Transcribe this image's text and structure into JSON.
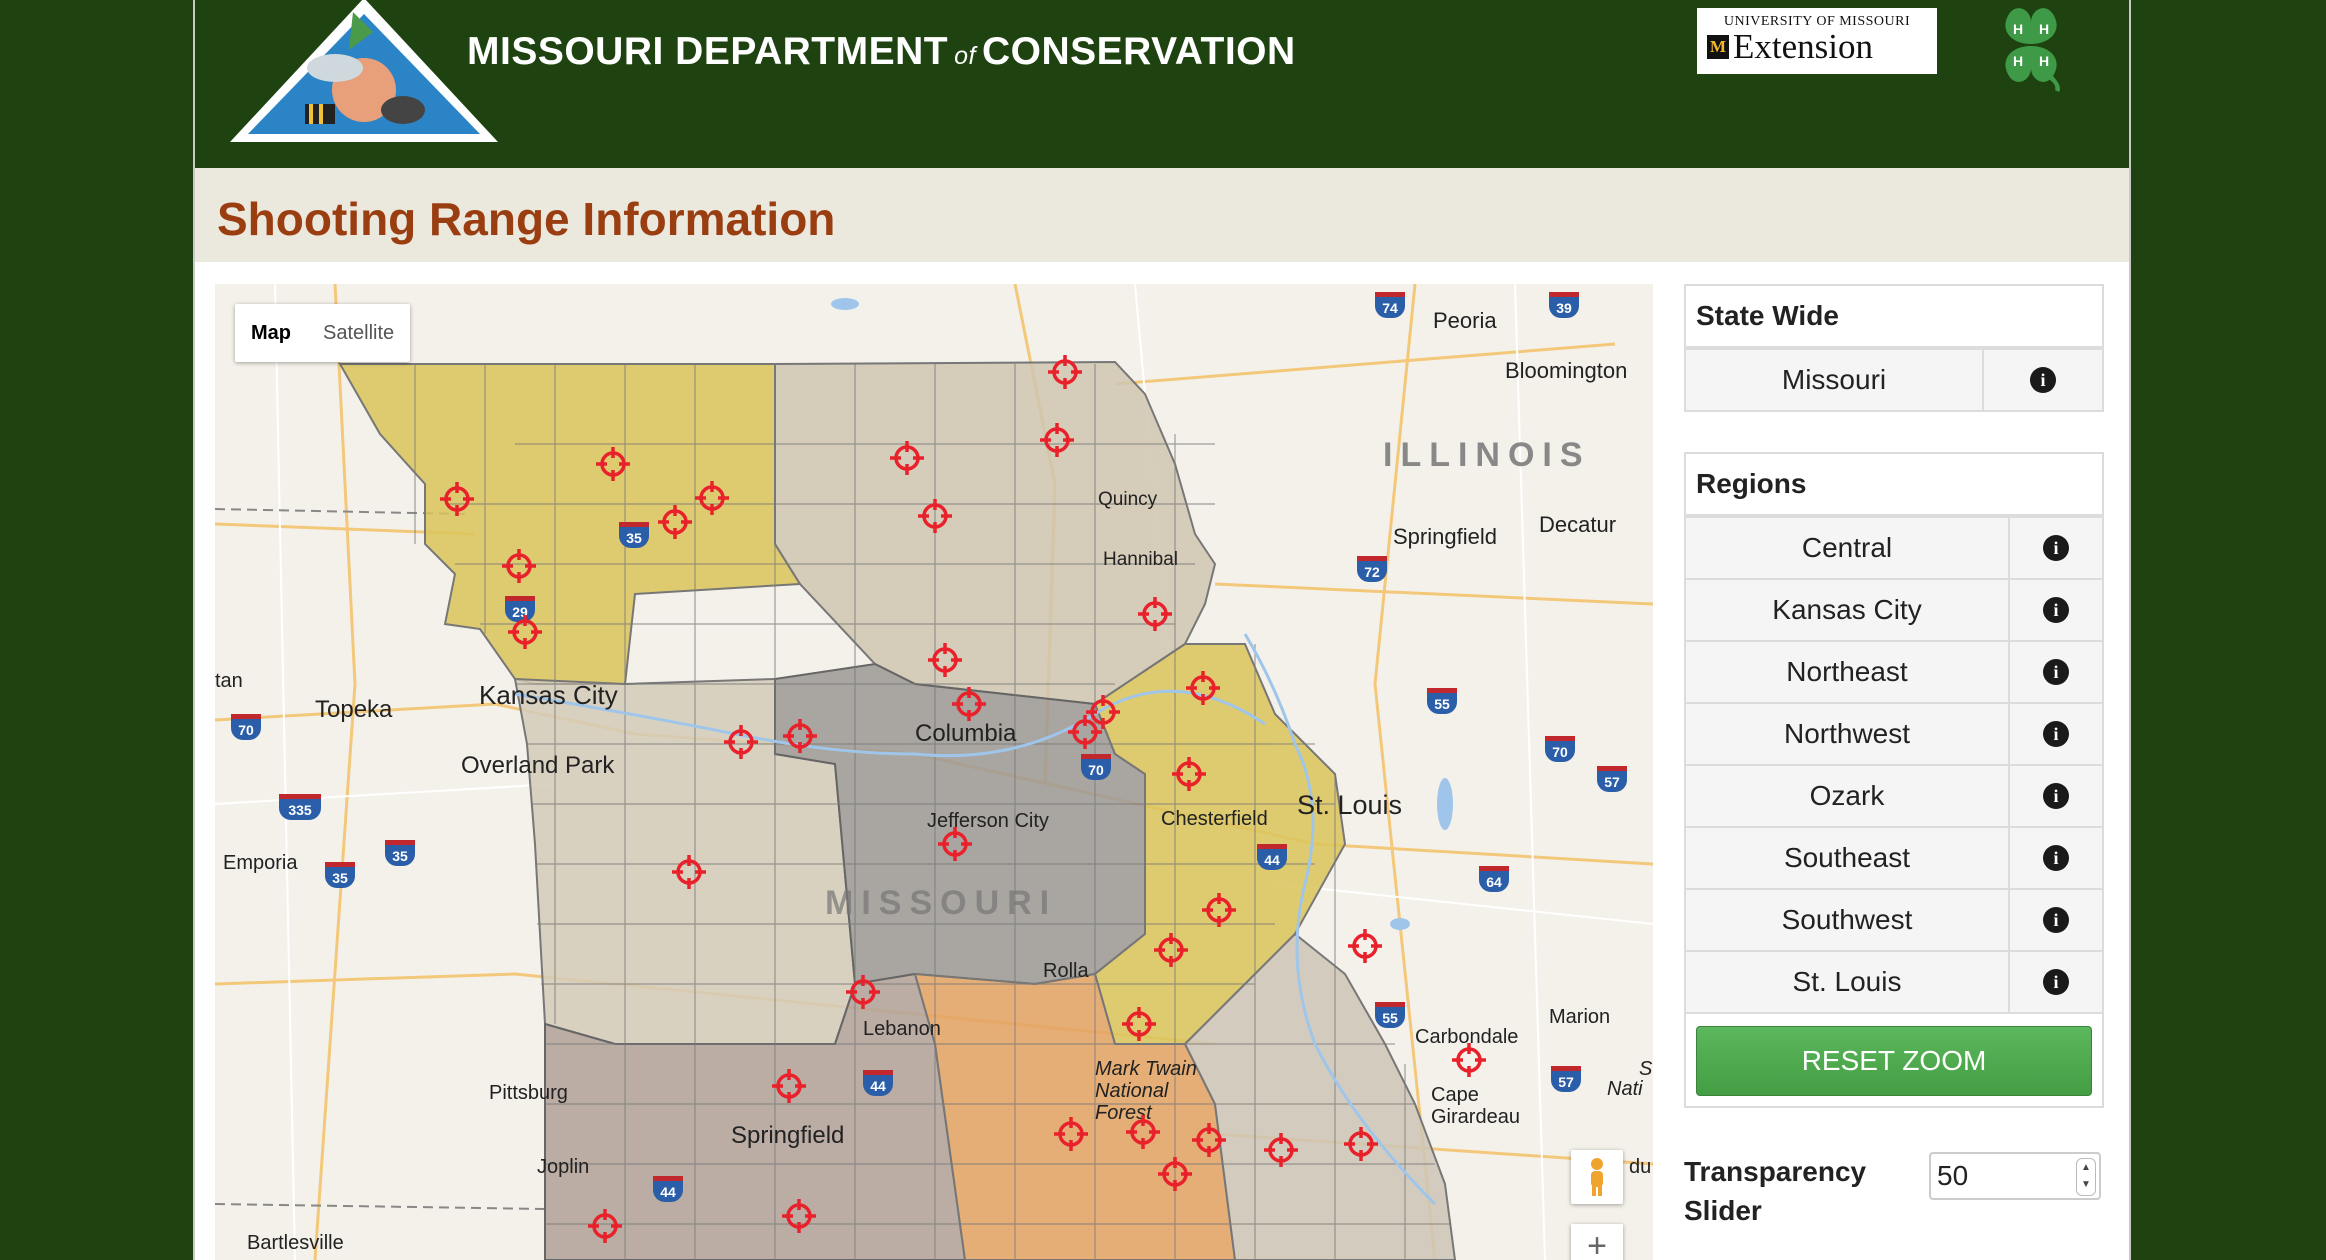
{
  "header": {
    "title_part1": "MISSOURI DEPARTMENT",
    "title_of": "of",
    "title_part2": "CONSERVATION",
    "extension_top": "UNIVERSITY OF MISSOURI",
    "extension_main": "Extension",
    "extension_mark": "M"
  },
  "page_title": "Shooting Range Information",
  "map": {
    "type_controls": [
      "Map",
      "Satellite"
    ],
    "active_type": "Map",
    "zoom_in": "+",
    "state_labels": [
      "ILLINOIS",
      "MISSOURI"
    ],
    "places": [
      "Peoria",
      "Bloomington",
      "Quincy",
      "Hannibal",
      "Springfield",
      "Decatur",
      "Kansas City",
      "Topeka",
      "Overland Park",
      "Columbia",
      "Jefferson City",
      "Chesterfield",
      "St. Louis",
      "Emporia",
      "Rolla",
      "Lebanon",
      "Mark Twain National Forest",
      "Marion",
      "Carbondale",
      "Cape Girardeau",
      "Pittsburg",
      "Springfield",
      "Joplin",
      "Bartlesville",
      "tan",
      "du",
      "Nati",
      "S"
    ],
    "highways": [
      "74",
      "39",
      "35",
      "72",
      "29",
      "55",
      "70",
      "70",
      "57",
      "70",
      "335",
      "35",
      "35",
      "44",
      "64",
      "55",
      "57",
      "44",
      "44"
    ],
    "region_colors": {
      "northwest": "#d9c45a",
      "northeast": "#cfc5b0",
      "central": "#9e9a95",
      "kansas_city": "#d3cbb8",
      "st_louis": "#d9c45a",
      "southwest": "#b3a39a",
      "ozark": "#e2a263",
      "southeast": "#ccc6b6"
    },
    "marker_color": "#e8212b"
  },
  "sidebar": {
    "statewide_title": "State Wide",
    "statewide_items": [
      "Missouri"
    ],
    "regions_title": "Regions",
    "regions": [
      "Central",
      "Kansas City",
      "Northeast",
      "Northwest",
      "Ozark",
      "Southeast",
      "Southwest",
      "St. Louis"
    ],
    "info_glyph": "i",
    "reset_zoom": "RESET ZOOM",
    "transparency_label": "Transparency Slider",
    "transparency_value": "50"
  }
}
